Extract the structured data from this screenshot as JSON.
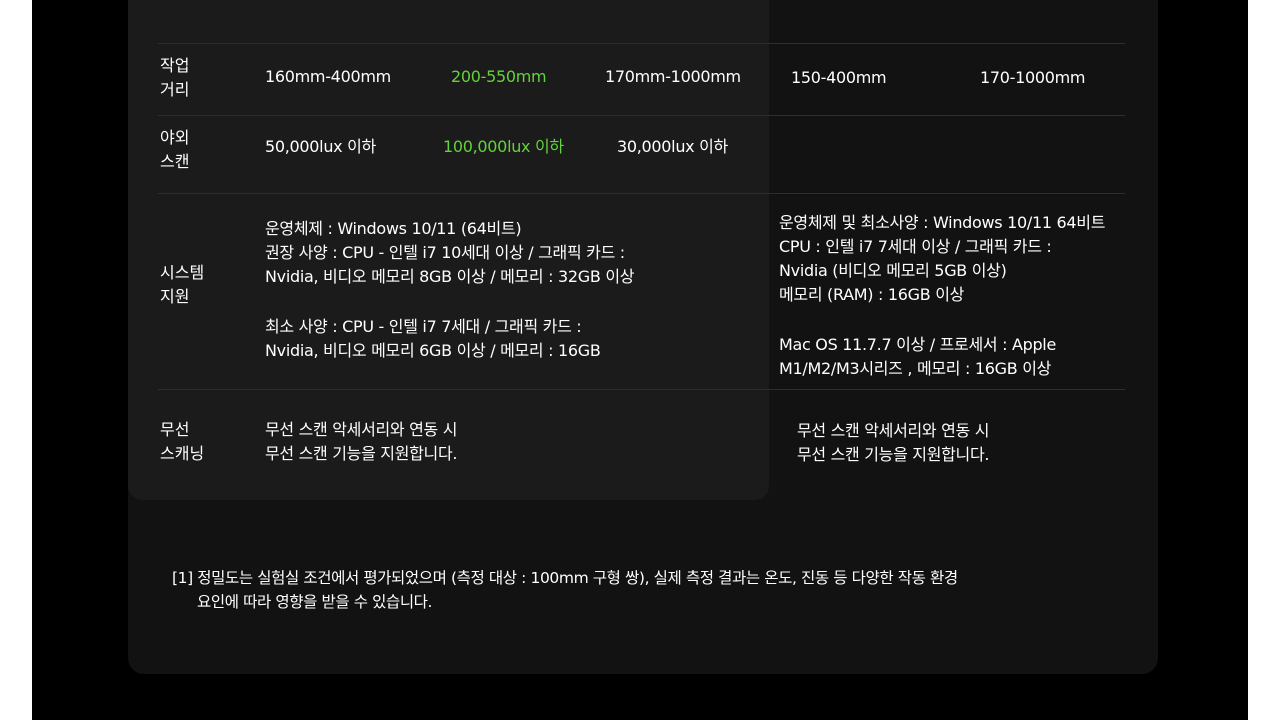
{
  "rows": {
    "working_distance": {
      "label_line1": "작업",
      "label_line2": "거리",
      "values": [
        "160mm-400mm",
        "200-550mm",
        "170mm-1000mm",
        "150-400mm",
        "170-1000mm"
      ]
    },
    "outdoor_scan": {
      "label_line1": "야외",
      "label_line2": "스캔",
      "values": [
        "50,000lux 이하",
        "100,000lux 이하",
        "30,000lux 이하"
      ]
    },
    "system_support": {
      "label_line1": "시스템",
      "label_line2": "지원",
      "left_lines": [
        "운영체제 : Windows 10/11 (64비트)",
        "권장 사양 : CPU - 인텔 i7 10세대 이상 / 그래픽 카드 :",
        "Nvidia, 비디오 메모리 8GB 이상 / 메모리 : 32GB 이상",
        "최소 사양 : CPU - 인텔 i7 7세대 / 그래픽 카드 :",
        "Nvidia, 비디오 메모리 6GB 이상 / 메모리 : 16GB"
      ],
      "right_lines": [
        "운영체제 및 최소사양 : Windows 10/11 64비트",
        "CPU : 인텔 i7 7세대 이상 / 그래픽 카드 :",
        "Nvidia (비디오 메모리 5GB 이상)",
        "메모리 (RAM) : 16GB 이상",
        "Mac OS 11.7.7 이상 / 프로세서 : Apple",
        "M1/M2/M3시리즈 , 메모리 : 16GB 이상"
      ]
    },
    "wireless_scanning": {
      "label_line1": "무선",
      "label_line2": "스캐닝",
      "left_lines": [
        "무선 스캔 악세서리와 연동 시",
        "무선 스캔 기능을 지원합니다."
      ],
      "right_lines": [
        "무선 스캔 악세서리와 연동 시",
        "무선 스캔 기능을 지원합니다."
      ]
    }
  },
  "footnote": {
    "line1": "[1] 정밀도는 실험실 조건에서 평가되었으며 (측정 대상 : 100mm 구형 쌍), 실제 측정 결과는 온도, 진동 등 다양한 작동 환경",
    "line2": "요인에 따라 영향을 받을 수 있습니다."
  },
  "colors": {
    "highlight": "#62d33a",
    "text": "#ffffff",
    "inner_card": "#1b1b1b",
    "outer_card": "#121212",
    "background": "#000000"
  }
}
